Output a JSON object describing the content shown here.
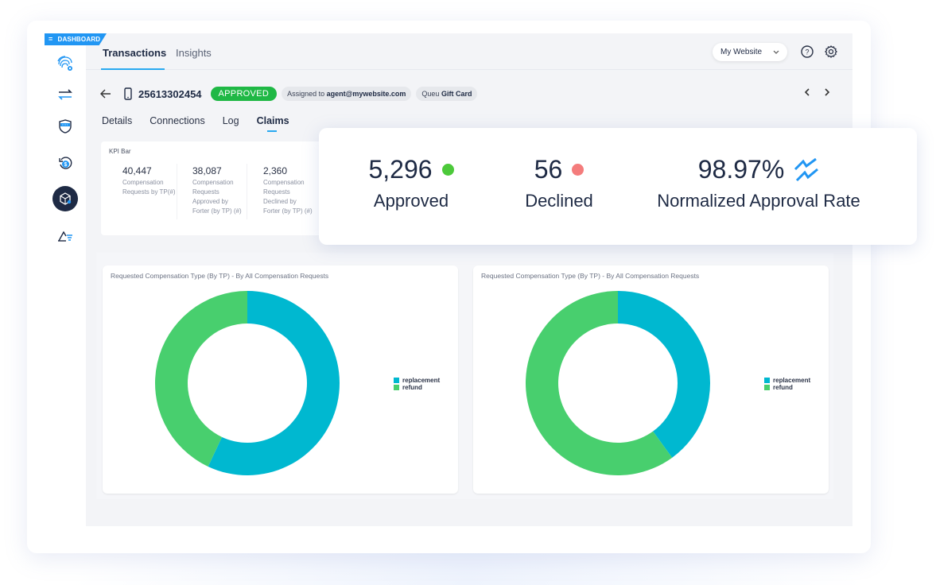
{
  "dashboard_tag": "DASHBOARD",
  "sidebar": {
    "items": [
      {
        "name": "fingerprint-icon",
        "active": false
      },
      {
        "name": "transfer-arrows-icon",
        "active": false
      },
      {
        "name": "shield-card-icon",
        "active": false
      },
      {
        "name": "refund-dollar-icon",
        "active": false
      },
      {
        "name": "cube-network-icon",
        "active": true
      },
      {
        "name": "chart-filter-icon",
        "active": false
      }
    ]
  },
  "header": {
    "tabs": [
      {
        "label": "Transactions",
        "active": true
      },
      {
        "label": "Insights",
        "active": false
      }
    ],
    "site_selector": "My Website",
    "help_icon": "help-circle-icon",
    "settings_icon": "gear-icon"
  },
  "transaction": {
    "id": "25613302454",
    "status": "APPROVED",
    "assigned_prefix": "Assigned to",
    "assigned_to": "agent@mywebsite.com",
    "queue_prefix": "Queu",
    "queue": "Gift Card"
  },
  "sub_tabs": [
    {
      "label": "Details",
      "active": false
    },
    {
      "label": "Connections",
      "active": false
    },
    {
      "label": "Log",
      "active": false
    },
    {
      "label": "Claims",
      "active": true
    }
  ],
  "kpi_bar": {
    "title": "KPI Bar",
    "items": [
      {
        "value": "40,447",
        "label": "Compensation Requests by TP(#)"
      },
      {
        "value": "38,087",
        "label": "Compensation Requests Approved by Forter (by TP) (#)"
      },
      {
        "value": "2,360",
        "label": "Compensation Requests Declined by Forter (by TP) (#)"
      }
    ]
  },
  "summary": {
    "approved": {
      "value": "5,296",
      "label": "Approved",
      "color": "#4cc93a"
    },
    "declined": {
      "value": "56",
      "label": "Declined",
      "color": "#f47c7c"
    },
    "rate": {
      "value": "98.97%",
      "label": "Normalized Approval Rate",
      "color": "#2196f3"
    }
  },
  "colors": {
    "replacement": "#00b8d0",
    "refund": "#48cf6e",
    "accent": "#29a9f0",
    "approved_badge": "#1fb845"
  },
  "chart_data": [
    {
      "type": "pie",
      "title": "Requested Compensation Type (By TP) - By All Compensation Requests",
      "categories": [
        "replacement",
        "refund"
      ],
      "values": [
        57,
        43
      ],
      "legend": "right",
      "donut": true
    },
    {
      "type": "pie",
      "title": "Requested Compensation Type (By TP) - By All Compensation Requests",
      "categories": [
        "replacement",
        "refund"
      ],
      "values": [
        40,
        60
      ],
      "legend": "right",
      "donut": true
    }
  ]
}
